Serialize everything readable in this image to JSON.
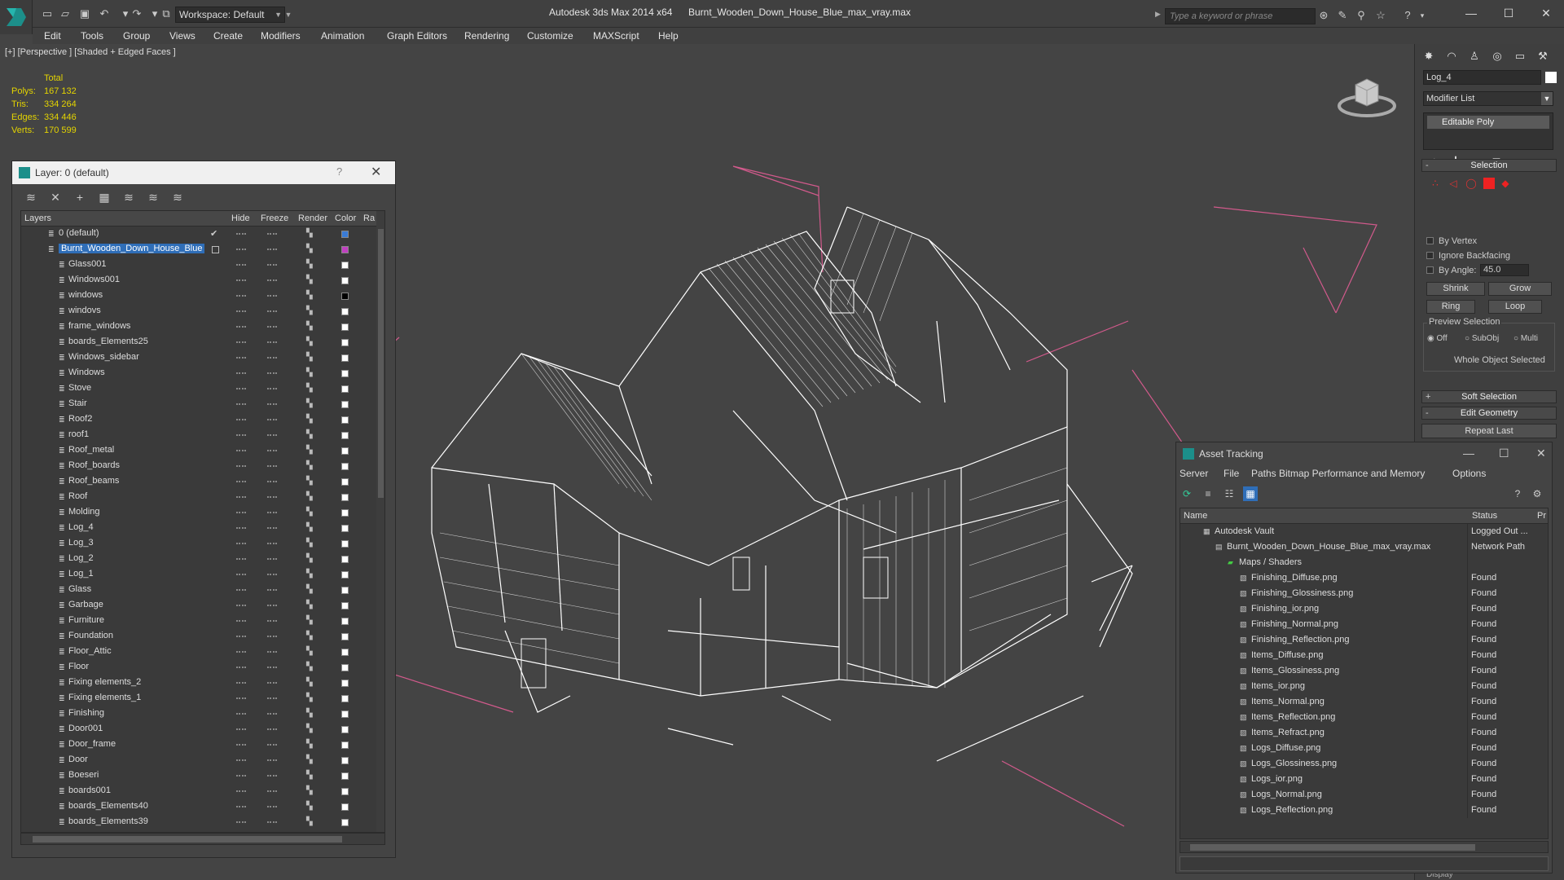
{
  "window": {
    "app_title": "Autodesk 3ds Max  2014 x64",
    "file_title": "Burnt_Wooden_Down_House_Blue_max_vray.max",
    "workspace": "Workspace: Default",
    "search_placeholder": "Type a keyword or phrase"
  },
  "menu": [
    "Edit",
    "Tools",
    "Group",
    "Views",
    "Create",
    "Modifiers",
    "Animation",
    "Graph Editors",
    "Rendering",
    "Customize",
    "MAXScript",
    "Help"
  ],
  "viewport": {
    "label": "[+] [Perspective ] [Shaded + Edged Faces ]",
    "stats_header": "Total",
    "stats": [
      {
        "label": "Polys:",
        "value": "167 132"
      },
      {
        "label": "Tris:",
        "value": "334 264"
      },
      {
        "label": "Edges:",
        "value": "334 446"
      },
      {
        "label": "Verts:",
        "value": "170 599"
      }
    ]
  },
  "layer_panel": {
    "title": "Layer: 0 (default)",
    "help": "?",
    "columns": [
      "Layers",
      "Hide",
      "Freeze",
      "Render",
      "Color",
      "Ra"
    ],
    "rows": [
      {
        "name": "0 (default)",
        "color": "#3a7bd5",
        "level": 0,
        "mark": "✔"
      },
      {
        "name": "Burnt_Wooden_Down_House_Blue",
        "color": "#c040c0",
        "level": 0,
        "selected": true
      },
      {
        "name": "Glass001",
        "color": "#ffffff",
        "level": 1
      },
      {
        "name": "Windows001",
        "color": "#ffffff",
        "level": 1
      },
      {
        "name": "windows",
        "color": "#000000",
        "level": 1
      },
      {
        "name": "windovs",
        "color": "#ffffff",
        "level": 1
      },
      {
        "name": "frame_windows",
        "color": "#ffffff",
        "level": 1
      },
      {
        "name": "boards_Elements25",
        "color": "#ffffff",
        "level": 1
      },
      {
        "name": "Windows_sidebar",
        "color": "#ffffff",
        "level": 1
      },
      {
        "name": "Windows",
        "color": "#ffffff",
        "level": 1
      },
      {
        "name": "Stove",
        "color": "#ffffff",
        "level": 1
      },
      {
        "name": "Stair",
        "color": "#ffffff",
        "level": 1
      },
      {
        "name": "Roof2",
        "color": "#ffffff",
        "level": 1
      },
      {
        "name": "roof1",
        "color": "#ffffff",
        "level": 1
      },
      {
        "name": "Roof_metal",
        "color": "#ffffff",
        "level": 1
      },
      {
        "name": "Roof_boards",
        "color": "#ffffff",
        "level": 1
      },
      {
        "name": "Roof_beams",
        "color": "#ffffff",
        "level": 1
      },
      {
        "name": "Roof",
        "color": "#ffffff",
        "level": 1
      },
      {
        "name": "Molding",
        "color": "#ffffff",
        "level": 1
      },
      {
        "name": "Log_4",
        "color": "#ffffff",
        "level": 1
      },
      {
        "name": "Log_3",
        "color": "#ffffff",
        "level": 1
      },
      {
        "name": "Log_2",
        "color": "#ffffff",
        "level": 1
      },
      {
        "name": "Log_1",
        "color": "#ffffff",
        "level": 1
      },
      {
        "name": "Glass",
        "color": "#ffffff",
        "level": 1
      },
      {
        "name": "Garbage",
        "color": "#ffffff",
        "level": 1
      },
      {
        "name": "Furniture",
        "color": "#ffffff",
        "level": 1
      },
      {
        "name": "Foundation",
        "color": "#ffffff",
        "level": 1
      },
      {
        "name": "Floor_Attic",
        "color": "#ffffff",
        "level": 1
      },
      {
        "name": "Floor",
        "color": "#ffffff",
        "level": 1
      },
      {
        "name": "Fixing elements_2",
        "color": "#ffffff",
        "level": 1
      },
      {
        "name": "Fixing elements_1",
        "color": "#ffffff",
        "level": 1
      },
      {
        "name": "Finishing",
        "color": "#ffffff",
        "level": 1
      },
      {
        "name": "Door001",
        "color": "#ffffff",
        "level": 1
      },
      {
        "name": "Door_frame",
        "color": "#ffffff",
        "level": 1
      },
      {
        "name": "Door",
        "color": "#ffffff",
        "level": 1
      },
      {
        "name": "Boeseri",
        "color": "#ffffff",
        "level": 1
      },
      {
        "name": "boards001",
        "color": "#ffffff",
        "level": 1
      },
      {
        "name": "boards_Elements40",
        "color": "#ffffff",
        "level": 1
      },
      {
        "name": "boards_Elements39",
        "color": "#ffffff",
        "level": 1
      }
    ]
  },
  "command_panel": {
    "object_name": "Log_4",
    "modifier_list": "Modifier List",
    "stack_item": "Editable Poly",
    "selection_title": "Selection",
    "by_vertex": "By Vertex",
    "ignore_backfacing": "Ignore Backfacing",
    "by_angle": "By Angle:",
    "angle_value": "45.0",
    "shrink": "Shrink",
    "grow": "Grow",
    "ring": "Ring",
    "loop": "Loop",
    "preview_selection": "Preview Selection",
    "off": "Off",
    "subobj": "SubObj",
    "multi": "Multi",
    "whole_object": "Whole Object Selected",
    "soft_selection": "Soft Selection",
    "edit_geometry": "Edit Geometry",
    "repeat_last": "Repeat Last",
    "display": "Display"
  },
  "asset_tracking": {
    "title": "Asset Tracking",
    "menu": [
      "Server",
      "File",
      "Paths",
      "Bitmap Performance and Memory",
      "Options"
    ],
    "columns": [
      "Name",
      "Status",
      "Pr"
    ],
    "rows": [
      {
        "name": "Autodesk Vault",
        "status": "Logged Out ...",
        "level": 0
      },
      {
        "name": "Burnt_Wooden_Down_House_Blue_max_vray.max",
        "status": "Network Path",
        "level": 1
      },
      {
        "name": "Maps / Shaders",
        "status": "",
        "level": 2
      },
      {
        "name": "Finishing_Diffuse.png",
        "status": "Found",
        "level": 3
      },
      {
        "name": "Finishing_Glossiness.png",
        "status": "Found",
        "level": 3
      },
      {
        "name": "Finishing_ior.png",
        "status": "Found",
        "level": 3
      },
      {
        "name": "Finishing_Normal.png",
        "status": "Found",
        "level": 3
      },
      {
        "name": "Finishing_Reflection.png",
        "status": "Found",
        "level": 3
      },
      {
        "name": "Items_Diffuse.png",
        "status": "Found",
        "level": 3
      },
      {
        "name": "Items_Glossiness.png",
        "status": "Found",
        "level": 3
      },
      {
        "name": "Items_ior.png",
        "status": "Found",
        "level": 3
      },
      {
        "name": "Items_Normal.png",
        "status": "Found",
        "level": 3
      },
      {
        "name": "Items_Reflection.png",
        "status": "Found",
        "level": 3
      },
      {
        "name": "Items_Refract.png",
        "status": "Found",
        "level": 3
      },
      {
        "name": "Logs_Diffuse.png",
        "status": "Found",
        "level": 3
      },
      {
        "name": "Logs_Glossiness.png",
        "status": "Found",
        "level": 3
      },
      {
        "name": "Logs_ior.png",
        "status": "Found",
        "level": 3
      },
      {
        "name": "Logs_Normal.png",
        "status": "Found",
        "level": 3
      },
      {
        "name": "Logs_Reflection.png",
        "status": "Found",
        "level": 3
      }
    ]
  },
  "colors": {
    "accent": "#2f6eb8",
    "stats_text": "#e4d400",
    "wireframe": "#ffffff",
    "grid_lines": "#d25a8c"
  }
}
